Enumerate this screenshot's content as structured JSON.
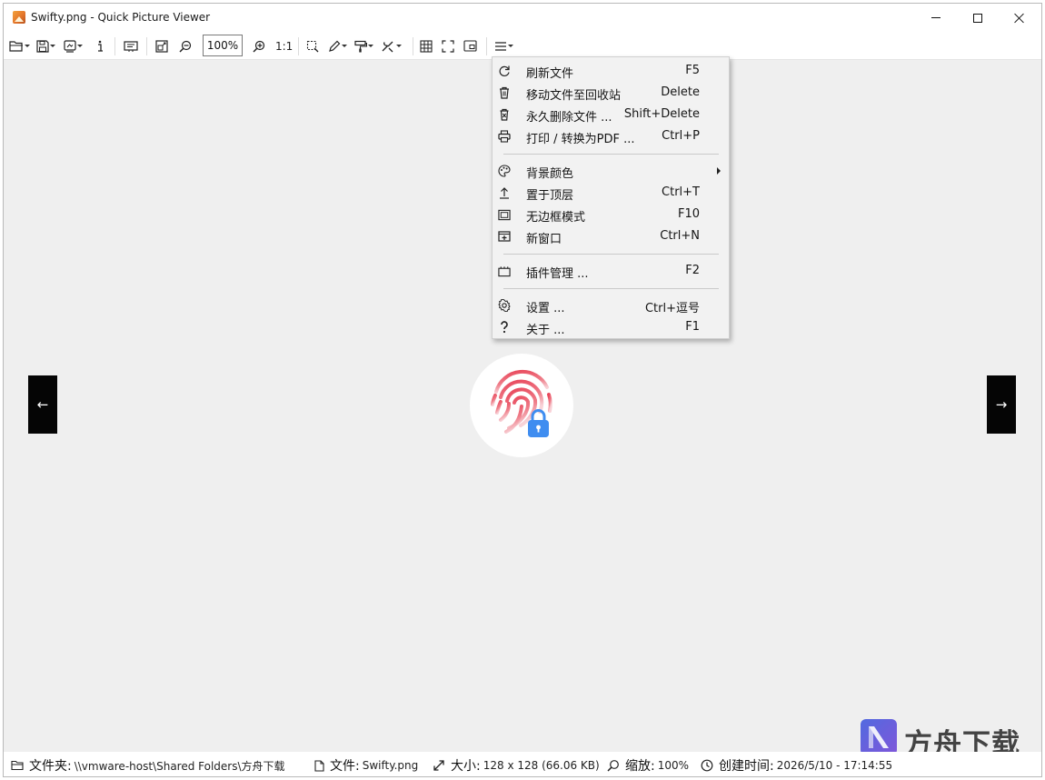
{
  "window": {
    "title": "Swifty.png - Quick Picture Viewer"
  },
  "toolbar": {
    "zoom_value": "100%",
    "actual_size_label": "1:1",
    "icons": [
      "open-folder-icon",
      "save-icon",
      "wallpaper-icon",
      "info-icon",
      "slideshow-icon",
      "autozoom-icon",
      "zoom-out-icon",
      "zoom-in-icon",
      "select-icon",
      "draw-icon",
      "paint-icon",
      "tools-icon",
      "grid-icon",
      "fullscreen-icon",
      "picture-in-picture-icon",
      "hamburger-menu-icon"
    ]
  },
  "menu": {
    "items": [
      {
        "label": "刷新文件",
        "shortcut": "F5",
        "icon": "refresh-icon"
      },
      {
        "label": "移动文件至回收站",
        "shortcut": "Delete",
        "icon": "trash-icon"
      },
      {
        "label": "永久删除文件 ...",
        "shortcut": "Shift+Delete",
        "icon": "delete-forever-icon"
      },
      {
        "label": "打印 / 转换为PDF ...",
        "shortcut": "Ctrl+P",
        "icon": "printer-icon"
      },
      {
        "label": "背景颜色",
        "shortcut": "",
        "icon": "palette-icon",
        "has_submenu": true
      },
      {
        "label": "置于顶层",
        "shortcut": "Ctrl+T",
        "icon": "pin-top-icon"
      },
      {
        "label": "无边框模式",
        "shortcut": "F10",
        "icon": "borderless-icon"
      },
      {
        "label": "新窗口",
        "shortcut": "Ctrl+N",
        "icon": "new-window-icon"
      },
      {
        "label": "插件管理 ...",
        "shortcut": "F2",
        "icon": "plugins-icon"
      },
      {
        "label": "设置 ...",
        "shortcut": "Ctrl+逗号",
        "icon": "settings-icon"
      },
      {
        "label": "关于 ...",
        "shortcut": "F1",
        "icon": "help-icon"
      }
    ]
  },
  "navigation": {
    "prev_glyph": "←",
    "next_glyph": "→"
  },
  "status": {
    "folder_label": "文件夹:",
    "folder_value": "\\\\vmware-host\\Shared Folders\\方舟下载",
    "file_label": "文件:",
    "file_value": "Swifty.png",
    "size_label": "大小:",
    "size_value": "128 x 128 (66.06 KB)",
    "zoom_label": "缩放:",
    "zoom_value": "100%",
    "created_label": "创建时间:",
    "created_value": "2026/5/10 - 17:14:55"
  },
  "watermark": {
    "text": "方舟下载"
  },
  "colors": {
    "canvas_bg": "#efefef",
    "menu_bg": "#f2f2f2",
    "nav_button_bg": "#050505",
    "fingerprint_red": "#e8465a",
    "lock_blue": "#3f8df0"
  }
}
